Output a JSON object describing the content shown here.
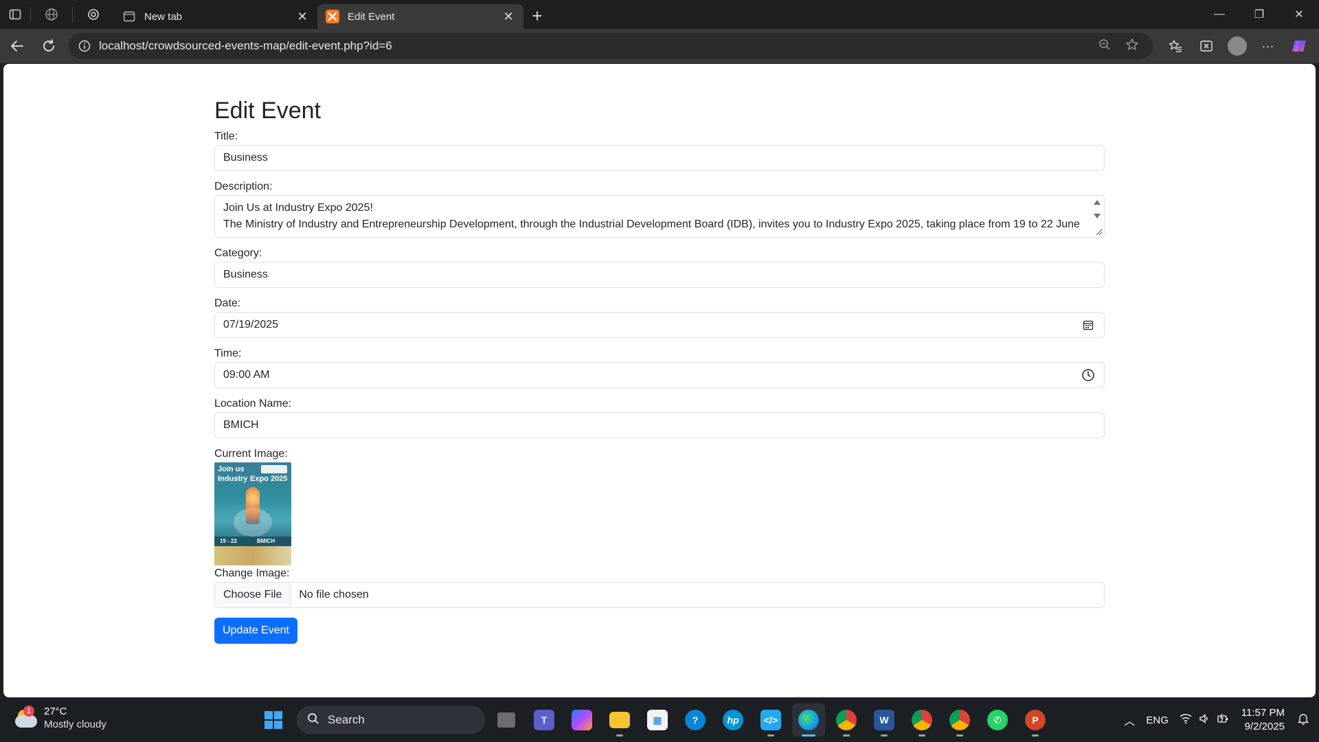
{
  "browser": {
    "tabs": [
      {
        "label": "New tab"
      },
      {
        "label": "Edit Event"
      }
    ],
    "url": "localhost/crowdsourced-events-map/edit-event.php?id=6"
  },
  "page": {
    "heading": "Edit Event",
    "fields": {
      "title": {
        "label": "Title:",
        "value": "Business"
      },
      "description": {
        "label": "Description:",
        "line1": "Join Us at Industry Expo 2025!",
        "line2": "The Ministry of Industry and Entrepreneurship Development, through the Industrial Development Board (IDB), invites you to Industry Expo 2025, taking place from 19 to 22 June"
      },
      "category": {
        "label": "Category:",
        "value": "Business"
      },
      "date": {
        "label": "Date:",
        "value": "07/19/2025"
      },
      "time": {
        "label": "Time:",
        "value": "09:00 AM"
      },
      "location": {
        "label": "Location Name:",
        "value": "BMICH"
      },
      "current_image": {
        "label": "Current Image:",
        "poster_line1": "Join us",
        "poster_line2": "Industry",
        "poster_line3": "Expo 2025",
        "poster_dates": "19 - 22",
        "poster_venue": "BMICH"
      },
      "change_image": {
        "label": "Change Image:",
        "button": "Choose File",
        "status": "No file chosen"
      }
    },
    "submit_label": "Update Event"
  },
  "taskbar": {
    "weather_temp": "27°C",
    "weather_desc": "Mostly cloudy",
    "weather_badge": "1",
    "search_label": "Search",
    "language": "ENG",
    "time": "11:57 PM",
    "date": "9/2/2025"
  },
  "colors": {
    "primary_button": "#0d6efd",
    "edge_active_indicator": "#4cc2ff"
  }
}
